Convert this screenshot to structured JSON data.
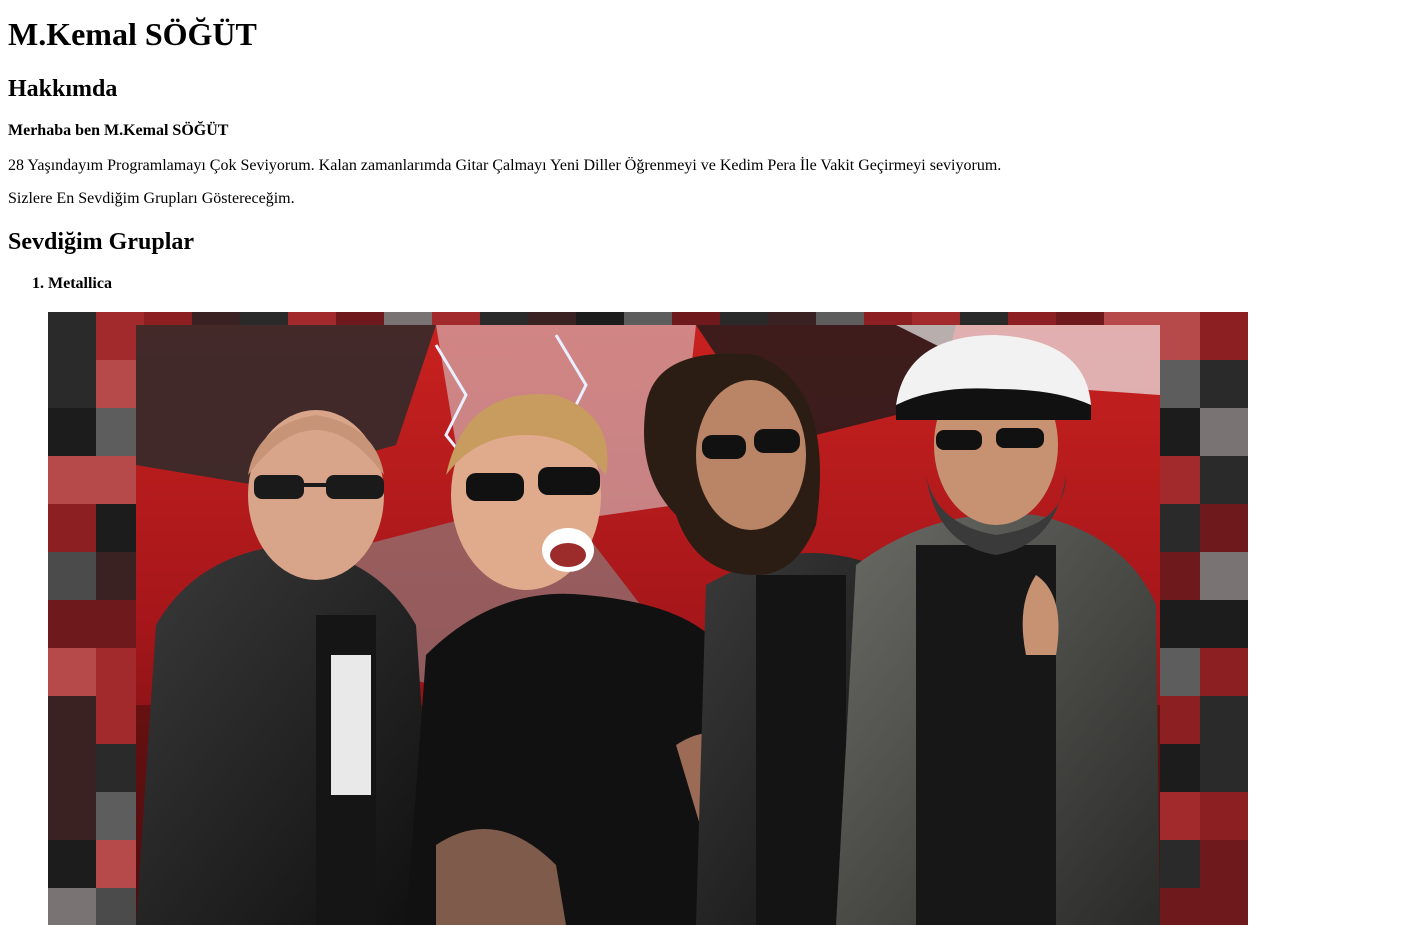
{
  "header": {
    "title": "M.Kemal SÖĞÜT"
  },
  "about": {
    "heading": "Hakkımda",
    "intro": "Merhaba ben M.Kemal SÖĞÜT",
    "bio": "28 Yaşındayım Programlamayı Çok Seviyorum. Kalan zamanlarımda Gitar Çalmayı Yeni Diller Öğrenmeyi ve Kedim Pera İle Vakit Geçirmeyi seviyorum.",
    "note": "Sizlere En Sevdiğim Grupları Göstereceğim."
  },
  "groups": {
    "heading": "Sevdiğim Gruplar",
    "items": [
      {
        "label": "Metallica"
      }
    ]
  },
  "colors": {
    "background_red": "#b3191c",
    "dark": "#151515",
    "cap_white": "#f2f2f2"
  }
}
